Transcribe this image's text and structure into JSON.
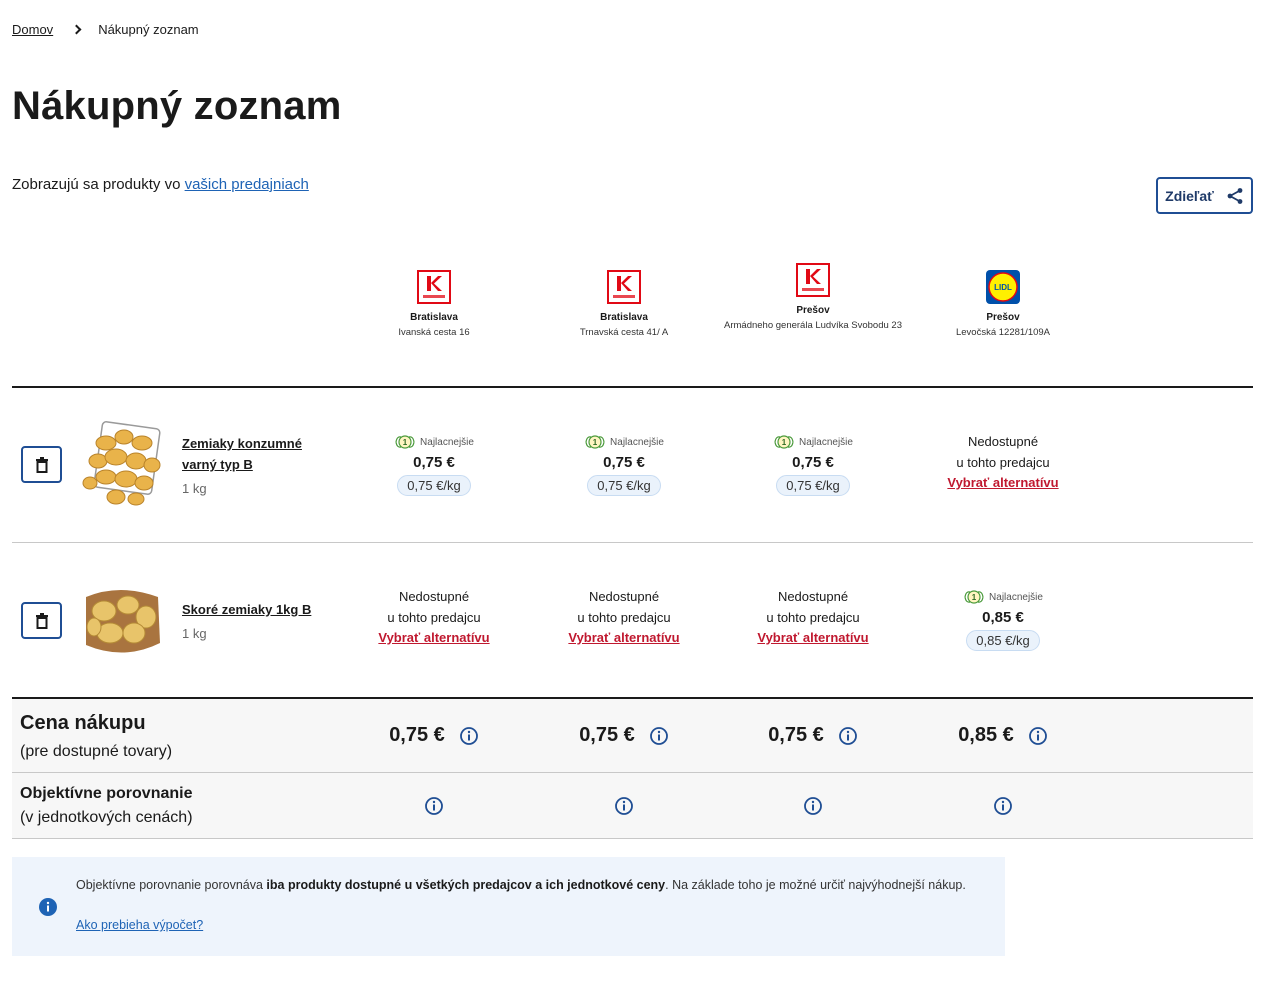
{
  "breadcrumb": {
    "home": "Domov",
    "current": "Nákupný zoznam"
  },
  "page": {
    "title": "Nákupný zoznam",
    "info_prefix": "Zobrazujú sa produkty vo ",
    "info_link": "vašich predajniach",
    "share_label": "Zdieľať"
  },
  "stores": [
    {
      "brand": "Kaufland",
      "city": "Bratislava",
      "address": "Ivanská cesta 16"
    },
    {
      "brand": "Kaufland",
      "city": "Bratislava",
      "address": "Trnavská cesta 41/ A"
    },
    {
      "brand": "Kaufland",
      "city": "Prešov",
      "address": "Armádneho generála Ludvíka Svobodu 23"
    },
    {
      "brand": "LIDL",
      "city": "Prešov",
      "address": "Levočská 12281/109A"
    }
  ],
  "products": [
    {
      "name_line1": "Zemiaky konzumné",
      "name_line2": "varný typ B",
      "qty": "1 kg",
      "offers": [
        {
          "badge": "Najlacnejšie",
          "price": "0,75 €",
          "unit": "0,75 €/kg"
        },
        {
          "badge": "Najlacnejšie",
          "price": "0,75 €",
          "unit": "0,75 €/kg"
        },
        {
          "badge": "Najlacnejšie",
          "price": "0,75 €",
          "unit": "0,75 €/kg"
        },
        {
          "na1": "Nedostupné",
          "na2": "u tohto predajcu",
          "alt": "Vybrať alternatívu"
        }
      ]
    },
    {
      "name_line1": "Skoré zemiaky 1kg B",
      "qty": "1 kg",
      "offers": [
        {
          "na1": "Nedostupné",
          "na2": "u tohto predajcu",
          "alt": "Vybrať alternatívu"
        },
        {
          "na1": "Nedostupné",
          "na2": "u tohto predajcu",
          "alt": "Vybrať alternatívu"
        },
        {
          "na1": "Nedostupné",
          "na2": "u tohto predajcu",
          "alt": "Vybrať alternatívu"
        },
        {
          "badge": "Najlacnejšie",
          "price": "0,85 €",
          "unit": "0,85 €/kg"
        }
      ]
    }
  ],
  "summary": {
    "title": "Cena nákupu",
    "subtitle": "(pre dostupné tovary)",
    "totals": [
      "0,75 €",
      "0,75 €",
      "0,75 €",
      "0,85 €"
    ],
    "compare_title": "Objektívne porovnanie",
    "compare_subtitle": "(v jednotkových cenách)"
  },
  "note": {
    "text_1": "Objektívne porovnanie porovnáva ",
    "text_bold": "iba produkty dostupné u všetkých predajcov a ich jednotkové ceny",
    "text_2": ". Na základe toho je možné určiť najvýhodnejší nákup.",
    "link": "Ako prebieha výpočet?"
  },
  "colors": {
    "accent": "#1f4e94",
    "link": "#1e63b5",
    "alternative": "#c0182f",
    "kaufland": "#e10915",
    "lidl_blue": "#0050aa",
    "lidl_yellow": "#fff000"
  }
}
